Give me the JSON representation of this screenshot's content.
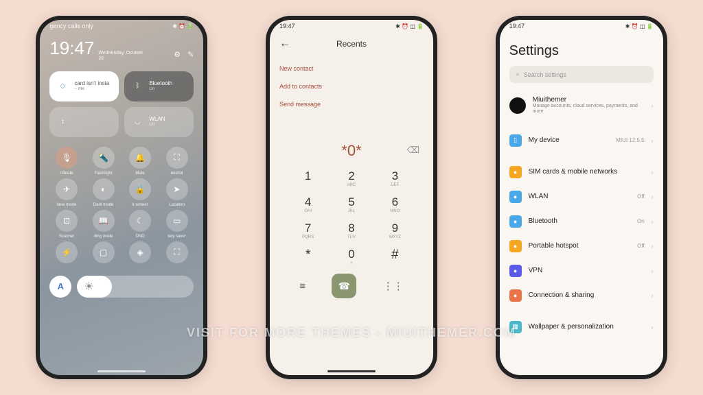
{
  "phone1": {
    "status": {
      "carrier": "gency calls only",
      "time": "19:47"
    },
    "clock": {
      "time": "19:47",
      "date_line1": "Wednesday, October",
      "date_line2": "20"
    },
    "tiles": {
      "data": {
        "title": "card isn't insta",
        "sub": "-- MB"
      },
      "bluetooth": {
        "title": "Bluetooth",
        "sub": "On"
      },
      "audio": {
        "title": "",
        "sub": ""
      },
      "wlan": {
        "title": "WLAN",
        "sub": "Off"
      }
    },
    "toggles": [
      {
        "label": "Vibrate",
        "icon": "🎙"
      },
      {
        "label": "Flashlight",
        "icon": "🔦"
      },
      {
        "label": "Mute",
        "icon": "🔔"
      },
      {
        "label": "enshot",
        "icon": "⛶"
      },
      {
        "label": "lane mode",
        "icon": "✈"
      },
      {
        "label": "Dark mode",
        "icon": "◐"
      },
      {
        "label": "k screen",
        "icon": "🔒"
      },
      {
        "label": "Location",
        "icon": "➤"
      },
      {
        "label": "Scanner",
        "icon": "⊡"
      },
      {
        "label": "ding mode",
        "icon": "📖"
      },
      {
        "label": "DND",
        "icon": "☾"
      },
      {
        "label": "tery saver",
        "icon": "▭"
      },
      {
        "label": "",
        "icon": "⚡"
      },
      {
        "label": "",
        "icon": "▢"
      },
      {
        "label": "",
        "icon": "◈"
      },
      {
        "label": "",
        "icon": "⛶"
      }
    ],
    "brightness_letter": "A"
  },
  "phone2": {
    "status_time": "19:47",
    "title": "Recents",
    "options": [
      "New contact",
      "Add to contacts",
      "Send message"
    ],
    "number": "*0*",
    "keys": [
      {
        "d": "1",
        "l": ""
      },
      {
        "d": "2",
        "l": "ABC"
      },
      {
        "d": "3",
        "l": "DEF"
      },
      {
        "d": "4",
        "l": "GHI"
      },
      {
        "d": "5",
        "l": "JKL"
      },
      {
        "d": "6",
        "l": "MNO"
      },
      {
        "d": "7",
        "l": "PQRS"
      },
      {
        "d": "8",
        "l": "TUV"
      },
      {
        "d": "9",
        "l": "WXYZ"
      },
      {
        "d": "*",
        "l": ""
      },
      {
        "d": "0",
        "l": "+"
      },
      {
        "d": "#",
        "l": ""
      }
    ]
  },
  "phone3": {
    "status_time": "19:47",
    "title": "Settings",
    "search_placeholder": "Search settings",
    "account": {
      "name": "Miuithemer",
      "sub": "Manage accounts, cloud services, payments, and more"
    },
    "mydevice": {
      "label": "My device",
      "value": "MIUI 12.5.5",
      "color": "#4aa8e8"
    },
    "items": [
      {
        "label": "SIM cards & mobile networks",
        "value": "",
        "color": "#f5a623"
      },
      {
        "label": "WLAN",
        "value": "Off",
        "color": "#4aa8e8"
      },
      {
        "label": "Bluetooth",
        "value": "On",
        "color": "#4aa8e8"
      },
      {
        "label": "Portable hotspot",
        "value": "Off",
        "color": "#f5a623"
      },
      {
        "label": "VPN",
        "value": "",
        "color": "#5b5be8"
      },
      {
        "label": "Connection & sharing",
        "value": "",
        "color": "#e8744a"
      }
    ],
    "wallpaper": {
      "label": "Wallpaper & personalization",
      "color": "#4ab8c8"
    }
  },
  "watermark": "VISIT FOR MORE THEMES - MIUITHEMER.COM"
}
